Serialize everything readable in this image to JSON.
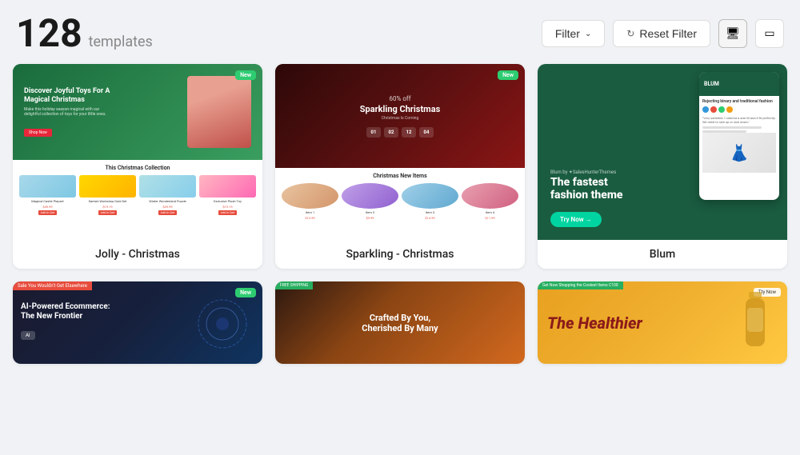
{
  "header": {
    "count": "128",
    "count_label": "templates",
    "filter_label": "Filter",
    "reset_label": "Reset Filter"
  },
  "cards": [
    {
      "id": "jolly",
      "label": "Jolly - Christmas",
      "badge": "New",
      "title_inner": "Discover Joyful Toys For A Magical Christmas",
      "sub_inner": "Make this holiday season magical with our delightful collection of toys for your little ones.",
      "cta_inner": "Shop Now",
      "bottom_title": "This Christmas Collection",
      "products": [
        {
          "name": "Magical Castle Playset",
          "old_price": "$49.99",
          "price": "$49.99",
          "btn": "Add to Cart"
        },
        {
          "name": "Santa's Workshop Gold Set",
          "old_price": "$29.99",
          "price": "$19.19",
          "btn": "Add to Cart"
        },
        {
          "name": "Winter Wonderland Puzzle",
          "old_price": "$34.99",
          "price": "$29.99",
          "btn": "Add to Cart"
        },
        {
          "name": "Exclusive Plush Toy",
          "old_price": "$29.99",
          "price": "$19.19",
          "btn": "Add to Cart"
        }
      ]
    },
    {
      "id": "sparkling",
      "label": "Sparkling - Christmas",
      "badge": "New",
      "title_inner": "60% off",
      "sub_title": "Sparkling Christmas",
      "coming_text": "Christmas Is Coming",
      "countdown": [
        "01",
        "02",
        "12",
        "04"
      ],
      "bottom_title": "Christmas New Items",
      "items": [
        {
          "name": "Item 1"
        },
        {
          "name": "Item 2"
        },
        {
          "name": "Item 3"
        },
        {
          "name": "Item 4"
        }
      ]
    },
    {
      "id": "blum",
      "label": "Blum",
      "by_text": "Blum by ✦SalesHunterThemes",
      "headline": "The fastest fashion theme",
      "try_btn": "Try Now →",
      "phone_logo": "BLUM"
    },
    {
      "id": "ai-ecommerce",
      "label": "",
      "sale_badge": "Sale You Wouldn't Get Elsewhere",
      "new_badge": "New",
      "headline": "AI-Powered Ecommerce: The New Frontier",
      "ai_label": "AI"
    },
    {
      "id": "crafted",
      "label": "",
      "free_shipping": "FREE SHIPPING",
      "headline": "Crafted By You, Cherished By Many"
    },
    {
      "id": "healthier",
      "label": "",
      "get_now": "Get Now Shopping the Coolest Items C100",
      "try_now": "Tty Now",
      "headline": "The Healthier"
    }
  ],
  "colors": {
    "badge_green": "#2ecc71",
    "cta_red": "#e74c3c",
    "blum_green": "#1a5c40",
    "blum_teal": "#00d4a0"
  }
}
